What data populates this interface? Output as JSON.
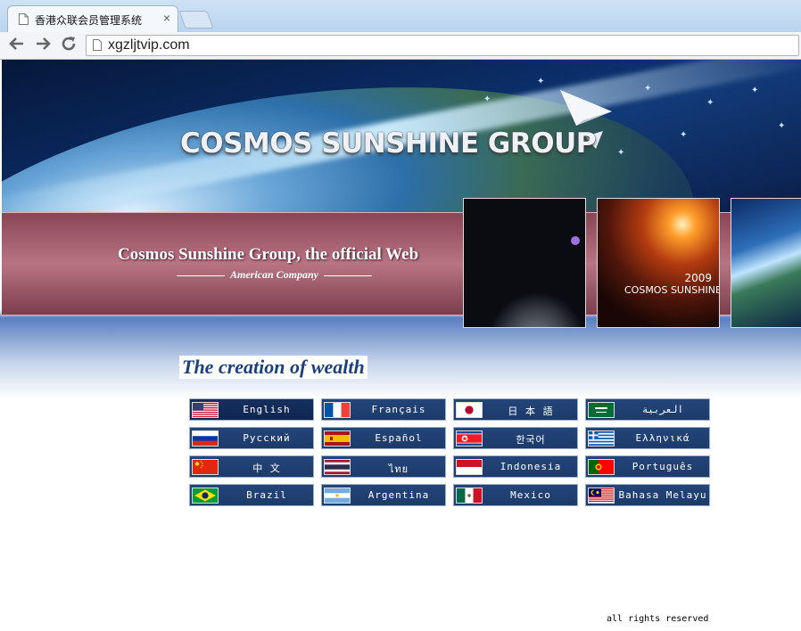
{
  "browser": {
    "tab_title": "香港众联会员管理系统",
    "tab_close": "×",
    "url": "xgzljtvip.com",
    "back_icon": "arrow-left-icon",
    "forward_icon": "arrow-right-icon",
    "reload_icon": "reload-icon"
  },
  "banner": {
    "logo_text": "COSMOS SUNSHINE GROUP"
  },
  "strip": {
    "title": "Cosmos Sunshine Group, the official Web",
    "subtitle": "American Company"
  },
  "thumbs": {
    "thumb2_year": "2009",
    "thumb2_caption": "COSMOS SUNSHINE"
  },
  "slogan": "The creation of wealth",
  "languages": [
    {
      "label": "English",
      "flag": "us-flag-icon"
    },
    {
      "label": "Français",
      "flag": "fr-flag-icon"
    },
    {
      "label": "日 本 語",
      "flag": "jp-flag-icon"
    },
    {
      "label": "ﺍﻟﻌﺮﺑﻴﺔ",
      "flag": "sa-flag-icon"
    },
    {
      "label": "Русский",
      "flag": "ru-flag-icon"
    },
    {
      "label": "Español",
      "flag": "es-flag-icon"
    },
    {
      "label": "한국어",
      "flag": "kp-flag-icon"
    },
    {
      "label": "Ελληνικά",
      "flag": "gr-flag-icon"
    },
    {
      "label": "中 文",
      "flag": "cn-flag-icon"
    },
    {
      "label": "ไทย",
      "flag": "th-flag-icon"
    },
    {
      "label": "Indonesia",
      "flag": "id-flag-icon"
    },
    {
      "label": "Português",
      "flag": "pt-flag-icon"
    },
    {
      "label": "Brazil",
      "flag": "br-flag-icon"
    },
    {
      "label": "Argentina",
      "flag": "ar-flag-icon"
    },
    {
      "label": "Mexico",
      "flag": "mx-flag-icon"
    },
    {
      "label": "Bahasa Melayu",
      "flag": "my-flag-icon"
    }
  ],
  "footer": "all rights reserved"
}
